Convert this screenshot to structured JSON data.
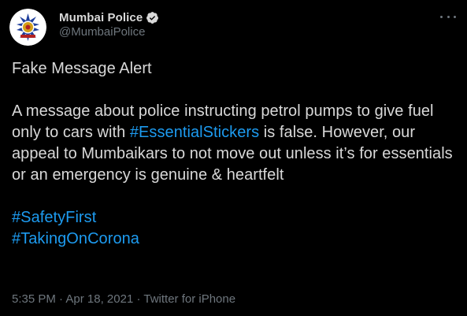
{
  "author": {
    "display_name": "Mumbai Police",
    "handle": "@MumbaiPolice",
    "avatar_icon": "mumbai-police-crest",
    "verified_icon": "verified-badge-icon"
  },
  "menu": {
    "icon": "more-icon"
  },
  "tweet": {
    "line_title": "Fake Message Alert",
    "para_part1": "A message about police instructing petrol pumps to give fuel only to cars with ",
    "hashtag_essential": "#EssentialStickers",
    "para_part2": " is false. However, our appeal to Mumbaikars to not move out unless it’s for essentials or an emergency is genuine & heartfelt",
    "hashtag_safety": "#SafetyFirst",
    "hashtag_corona": "#TakingOnCorona"
  },
  "meta": {
    "time": "5:35 PM",
    "sep1": " · ",
    "date": "Apr 18, 2021",
    "sep2": " · ",
    "source": "Twitter for iPhone"
  },
  "colors": {
    "background": "#000000",
    "text": "#d9d9d9",
    "secondary": "#6e767d",
    "link": "#1d9bf0",
    "verified": "#d9d9d9"
  }
}
